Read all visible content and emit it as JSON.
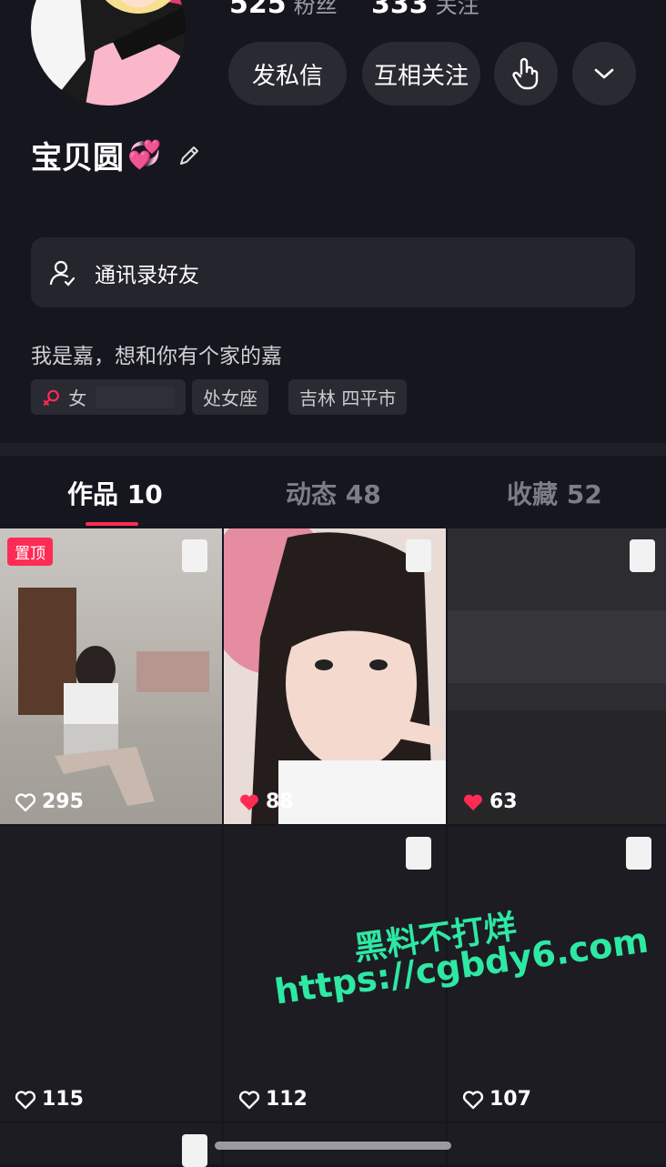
{
  "profile": {
    "fans_count": "525",
    "fans_label": "粉丝",
    "following_count": "333",
    "following_label": "关注",
    "name": "宝贝圆",
    "name_emoji": "💞",
    "bio": "我是嘉，想和你有个家的嘉"
  },
  "actions": {
    "message": "发私信",
    "mutual_follow": "互相关注"
  },
  "contact_friends": {
    "label": "通讯录好友"
  },
  "tags": [
    {
      "label": "女",
      "icon": "female-icon"
    },
    {
      "label": "处女座"
    },
    {
      "label": "吉林 四平市"
    }
  ],
  "tabs": [
    {
      "label": "作品 10",
      "active": true
    },
    {
      "label": "动态 48",
      "active": false
    },
    {
      "label": "收藏 52",
      "active": false
    }
  ],
  "grid": [
    {
      "likes": "295",
      "pinned_label": "置顶",
      "liked": false
    },
    {
      "likes": "88",
      "liked": true
    },
    {
      "likes": "63",
      "liked": true
    },
    {
      "likes": "115",
      "liked": false
    },
    {
      "likes": "112",
      "liked": false
    },
    {
      "likes": "107",
      "liked": false
    }
  ],
  "watermark": {
    "line1": "黑料不打烊",
    "line2": "https://cgbdy6.com"
  },
  "colors": {
    "background": "#16161e",
    "accent": "#fe2c55",
    "watermark": "#2ee8a4"
  }
}
